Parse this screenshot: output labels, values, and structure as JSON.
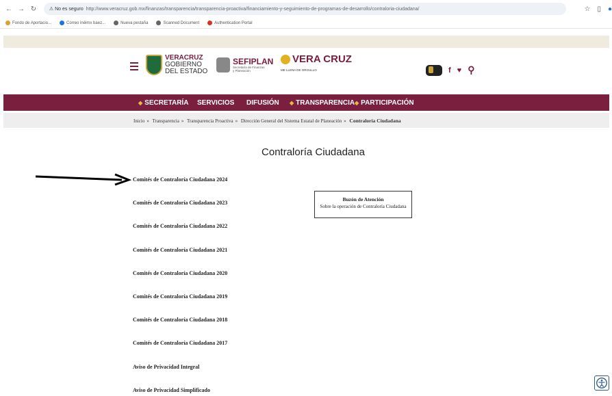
{
  "browser": {
    "security_label": "⚠ No es seguro",
    "url": "http://www.veracruz.gob.mx/finanzas/transparencia/transparencia-proactiva/financiamiento-y-seguimiento-de-programas-de-desarrollo/contraloria-ciudadana/",
    "bookmarks": [
      {
        "label": "Fondo de Aportacio...",
        "color": "#e0a030"
      },
      {
        "label": "Correo inéimx baez...",
        "color": "#1a73e8"
      },
      {
        "label": "Nueva pestaña",
        "color": "#666666"
      },
      {
        "label": "Scanned Document",
        "color": "#666666"
      },
      {
        "label": "Authentication Portal",
        "color": "#d93025"
      }
    ]
  },
  "header": {
    "logo1": {
      "line1": "VERACRUZ",
      "line2": "GOBIERNO",
      "line3": "DEL ESTADO"
    },
    "logo2": {
      "main": "SEFIPLAN",
      "sub": "Secretaría de Finanzas y Planeación"
    },
    "logo3": {
      "main": "VERA CRUZ",
      "sub": "ME LLENA DE ORGULLO"
    }
  },
  "nav": {
    "items": [
      "SECRETARÍA",
      "SERVICIOS",
      "DIFUSIÓN",
      "TRANSPARENCIA",
      "PARTICIPACIÓN"
    ]
  },
  "breadcrumb": {
    "items": [
      "Inicio",
      "Transparencia",
      "Transparencia Proactiva",
      "Dirección General del Sistema Estatal de Planeación"
    ],
    "current": "Contraloría Ciudadana",
    "separator": "»"
  },
  "page": {
    "title": "Contraloría Ciudadana",
    "links": [
      "Comités de Contraloría Ciudadana 2024",
      "Comités de Contraloría Ciudadana 2023",
      "Comités de Contraloría Ciudadana 2022",
      "Comités de Contraloría Ciudadana 2021",
      "Comités de Contraloría Ciudadana 2020",
      "Comités de Contraloría Ciudadana 2019",
      "Comités de Contraloría Ciudadana 2018",
      "Comités de Contraloría Ciudadana 2017",
      "Aviso de Privacidad Integral",
      "Aviso de Privacidad Simplificado"
    ],
    "box": {
      "title": "Buzón de Atención",
      "subtitle": "Sobre la operación de Contraloría Ciudadana"
    }
  },
  "colors": {
    "brand": "#7b1f3f",
    "accent": "#e8b64a"
  }
}
